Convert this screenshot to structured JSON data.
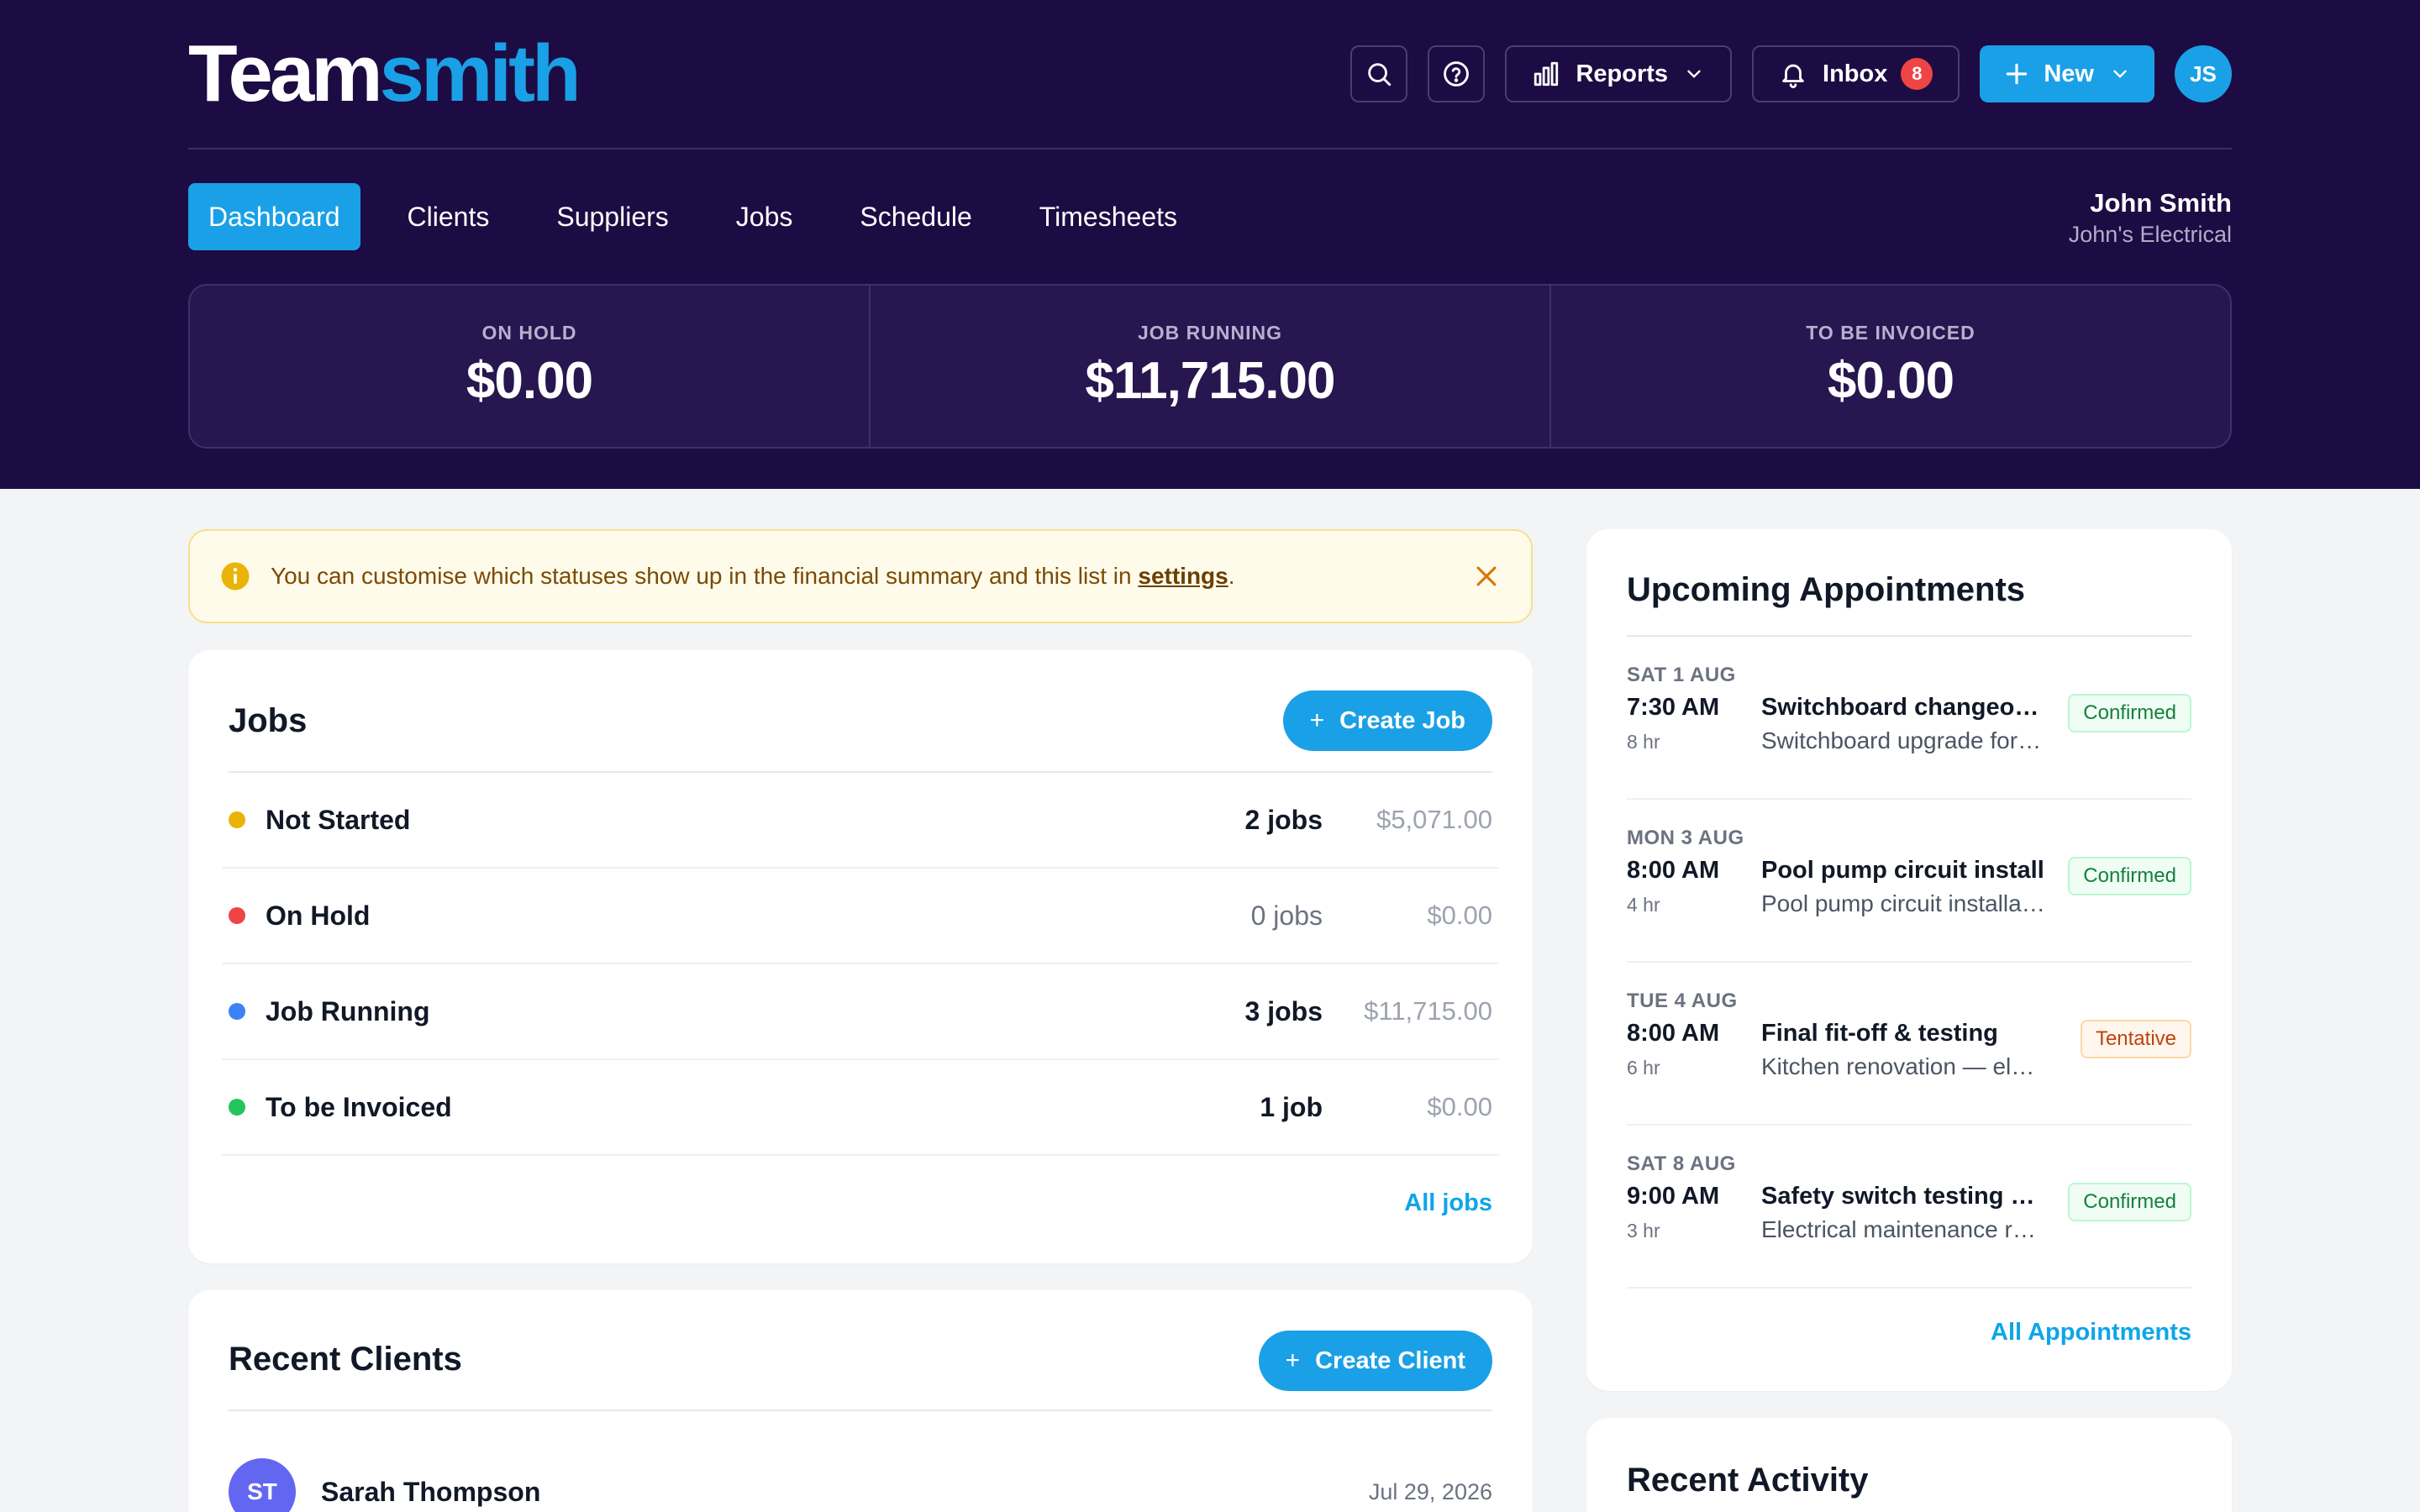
{
  "brand": {
    "part1": "Team",
    "part2": "smith"
  },
  "top_actions": {
    "reports_label": "Reports",
    "inbox_label": "Inbox",
    "inbox_count": "8",
    "new_label": "New",
    "avatar_initials": "JS"
  },
  "nav": {
    "items": [
      {
        "label": "Dashboard",
        "active": true
      },
      {
        "label": "Clients"
      },
      {
        "label": "Suppliers"
      },
      {
        "label": "Jobs"
      },
      {
        "label": "Schedule"
      },
      {
        "label": "Timesheets"
      }
    ]
  },
  "user": {
    "name": "John Smith",
    "company": "John's Electrical"
  },
  "summary": [
    {
      "label": "ON HOLD",
      "value": "$0.00"
    },
    {
      "label": "JOB RUNNING",
      "value": "$11,715.00"
    },
    {
      "label": "TO BE INVOICED",
      "value": "$0.00"
    }
  ],
  "notice": {
    "text": "You can customise which statuses show up in the financial summary and this list in ",
    "link": "settings",
    "end": "."
  },
  "jobs": {
    "title": "Jobs",
    "create_label": "Create Job",
    "rows": [
      {
        "name": "Not Started",
        "count": "2 jobs",
        "amount": "$5,071.00",
        "color": "#eab308"
      },
      {
        "name": "On Hold",
        "count": "0 jobs",
        "amount": "$0.00",
        "color": "#ef4444"
      },
      {
        "name": "Job Running",
        "count": "3 jobs",
        "amount": "$11,715.00",
        "color": "#3b82f6"
      },
      {
        "name": "To be Invoiced",
        "count": "1 job",
        "amount": "$0.00",
        "color": "#22c55e"
      }
    ],
    "all_link": "All jobs"
  },
  "clients": {
    "title": "Recent Clients",
    "create_label": "Create Client",
    "rows": [
      {
        "initials": "ST",
        "name": "Sarah Thompson",
        "date": "Jul 29, 2026"
      }
    ]
  },
  "appointments": {
    "title": "Upcoming Appointments",
    "items": [
      {
        "date": "SAT 1 AUG",
        "time": "7:30 AM",
        "duration": "8 hr",
        "name": "Switchboard changeover",
        "desc": "Switchboard upgrade for residence",
        "status": "Confirmed"
      },
      {
        "date": "MON 3 AUG",
        "time": "8:00 AM",
        "duration": "4 hr",
        "name": "Pool pump circuit install",
        "desc": "Pool pump circuit installation",
        "status": "Confirmed"
      },
      {
        "date": "TUE 4 AUG",
        "time": "8:00 AM",
        "duration": "6 hr",
        "name": "Final fit-off & testing",
        "desc": "Kitchen renovation — electrical",
        "status": "Tentative"
      },
      {
        "date": "SAT 8 AUG",
        "time": "9:00 AM",
        "duration": "3 hr",
        "name": "Safety switch testing and tagging",
        "desc": "Electrical maintenance round",
        "status": "Confirmed"
      }
    ],
    "all_link": "All Appointments"
  },
  "activity": {
    "title": "Recent Activity"
  },
  "colors": {
    "header_bg": "#1c0c43",
    "accent": "#1aa0e6",
    "badge": "#ef4444"
  },
  "icons": [
    "search-icon",
    "help-icon",
    "bar-chart-icon",
    "chevron-down-icon",
    "bell-icon",
    "plus-icon",
    "info-icon",
    "close-icon"
  ]
}
